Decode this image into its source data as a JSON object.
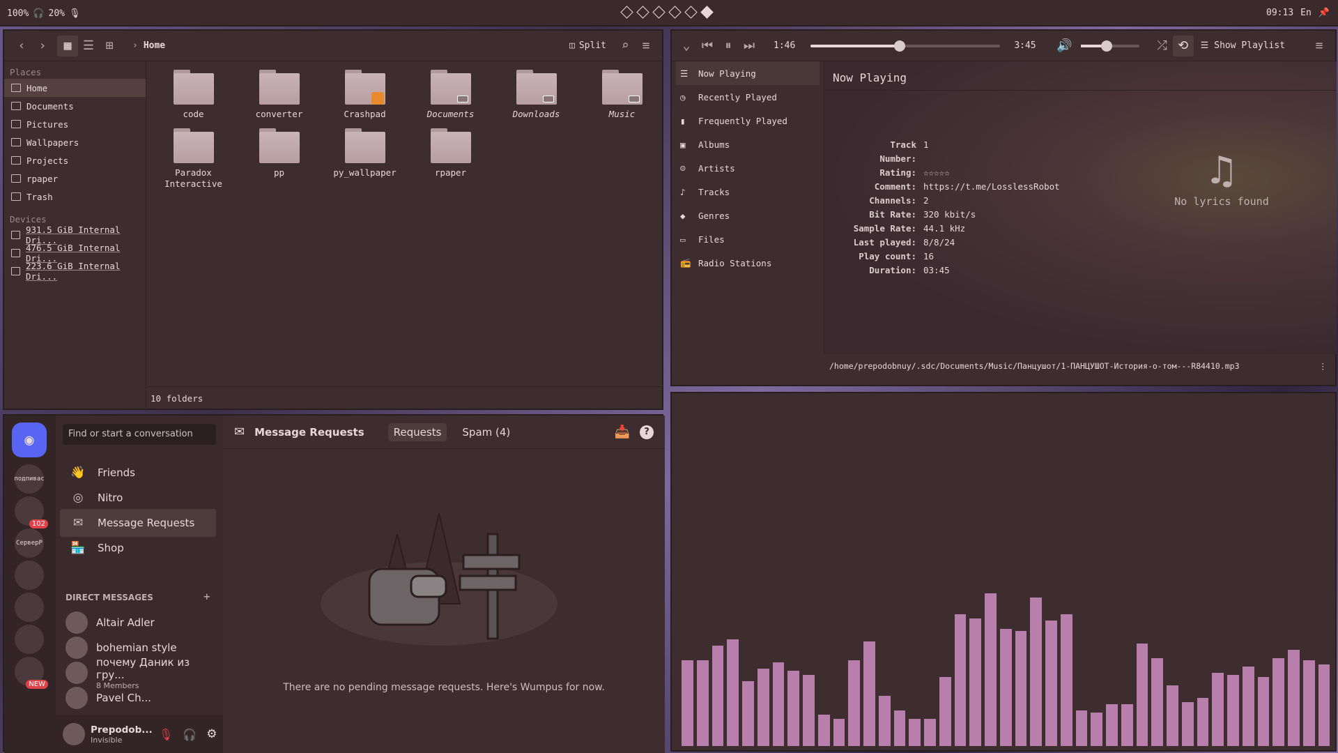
{
  "topbar": {
    "battery": "100%",
    "headphone_battery": "20%",
    "workspaces": 6,
    "active_workspace": 6,
    "time": "09:13",
    "lang": "En"
  },
  "file_manager": {
    "path": "Home",
    "split_label": "Split",
    "places_title": "Places",
    "places": [
      {
        "label": "Home",
        "selected": true
      },
      {
        "label": "Documents"
      },
      {
        "label": "Pictures"
      },
      {
        "label": "Wallpapers"
      },
      {
        "label": "Projects"
      },
      {
        "label": "rpaper"
      },
      {
        "label": "Trash"
      }
    ],
    "devices_title": "Devices",
    "devices": [
      {
        "label": "931.5 GiB Internal Dri..."
      },
      {
        "label": "476.5 GiB Internal Dri..."
      },
      {
        "label": "223.6 GiB Internal Dri..."
      }
    ],
    "folders": [
      {
        "name": "code"
      },
      {
        "name": "converter"
      },
      {
        "name": "Crashpad",
        "badge": "lock"
      },
      {
        "name": "Documents",
        "italic": true,
        "badge": "link"
      },
      {
        "name": "Downloads",
        "italic": true,
        "badge": "link"
      },
      {
        "name": "Music",
        "italic": true,
        "badge": "link"
      },
      {
        "name": "Paradox Interactive"
      },
      {
        "name": "pp"
      },
      {
        "name": "py_wallpaper"
      },
      {
        "name": "rpaper"
      }
    ],
    "status": "10 folders"
  },
  "player": {
    "elapsed": "1:46",
    "total": "3:45",
    "progress": 0.47,
    "volume": 0.45,
    "show_playlist": "Show Playlist",
    "nav": [
      {
        "label": "Now Playing",
        "icon": "list-icon",
        "selected": true
      },
      {
        "label": "Recently Played",
        "icon": "clock-icon"
      },
      {
        "label": "Frequently Played",
        "icon": "bar-chart-icon"
      },
      {
        "label": "Albums",
        "icon": "album-icon"
      },
      {
        "label": "Artists",
        "icon": "person-icon"
      },
      {
        "label": "Tracks",
        "icon": "note-icon"
      },
      {
        "label": "Genres",
        "icon": "genre-icon"
      },
      {
        "label": "Files",
        "icon": "folder-icon"
      },
      {
        "label": "Radio Stations",
        "icon": "radio-icon"
      }
    ],
    "heading": "Now Playing",
    "info": [
      {
        "k": "Track Number:",
        "v": "1"
      },
      {
        "k": "Rating:",
        "v": "☆☆☆☆☆"
      },
      {
        "k": "Comment:",
        "v": "https://t.me/LosslessRobot"
      },
      {
        "k": "Channels:",
        "v": "2"
      },
      {
        "k": "Bit Rate:",
        "v": "320 kbit/s"
      },
      {
        "k": "Sample Rate:",
        "v": "44.1 kHz"
      },
      {
        "k": "Last played:",
        "v": "8/8/24"
      },
      {
        "k": "Play count:",
        "v": "16"
      },
      {
        "k": "Duration:",
        "v": "03:45"
      }
    ],
    "lyrics": "No lyrics found",
    "file_path": "/home/prepodobnuy/.sdc/Documents/Music/Панцушот/1-ПАНЦУШОТ-История-о-том---R84410.mp3"
  },
  "discord": {
    "search_placeholder": "Find or start a conversation",
    "nav": [
      {
        "label": "Friends"
      },
      {
        "label": "Nitro"
      },
      {
        "label": "Message Requests",
        "selected": true
      },
      {
        "label": "Shop"
      }
    ],
    "dm_header": "DIRECT MESSAGES",
    "dms": [
      {
        "name": "Altair Adler"
      },
      {
        "name": "bohemian style"
      },
      {
        "name": "почему Даник из гру...",
        "sub": "8 Members"
      },
      {
        "name": "Pavel Ch..."
      }
    ],
    "header_title": "Message Requests",
    "tab_requests": "Requests",
    "tab_spam": "Spam (4)",
    "empty": "There are no pending message requests. Here's Wumpus for now.",
    "user": {
      "name": "Prepodob...",
      "status": "Invisible"
    },
    "servers": [
      {
        "label": "подпивас"
      },
      {
        "label": "",
        "badge": "102"
      },
      {
        "label": "СерверР"
      },
      {
        "label": ""
      },
      {
        "label": ""
      },
      {
        "label": ""
      },
      {
        "label": "",
        "badge": "NEW"
      }
    ]
  },
  "visualizer": {
    "levels": [
      0.41,
      0.41,
      0.48,
      0.51,
      0.31,
      0.37,
      0.4,
      0.36,
      0.34,
      0.15,
      0.13,
      0.41,
      0.5,
      0.24,
      0.17,
      0.13,
      0.13,
      0.33,
      0.63,
      0.61,
      0.73,
      0.56,
      0.55,
      0.71,
      0.6,
      0.63,
      0.17,
      0.16,
      0.2,
      0.2,
      0.49,
      0.42,
      0.29,
      0.21,
      0.23,
      0.35,
      0.34,
      0.38,
      0.33,
      0.42,
      0.46,
      0.41,
      0.39
    ]
  }
}
